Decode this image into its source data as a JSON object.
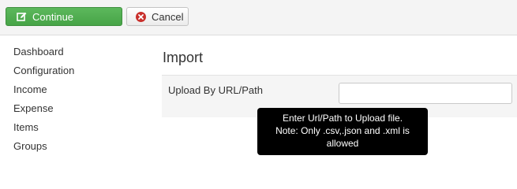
{
  "toolbar": {
    "continue_label": "Continue",
    "cancel_label": "Cancel",
    "continue_color": "#5cb85c",
    "cancel_icon_color": "#c9302c"
  },
  "sidebar": {
    "items": [
      {
        "label": "Dashboard"
      },
      {
        "label": "Configuration"
      },
      {
        "label": "Income"
      },
      {
        "label": "Expense"
      },
      {
        "label": "Items"
      },
      {
        "label": "Groups"
      }
    ]
  },
  "main": {
    "title": "Import",
    "upload_label": "Upload By URL/Path",
    "upload_value": "",
    "tooltip_lines": [
      "Enter Url/Path to Upload file.",
      "Note: Only .csv,.json and .xml is",
      "allowed"
    ]
  }
}
